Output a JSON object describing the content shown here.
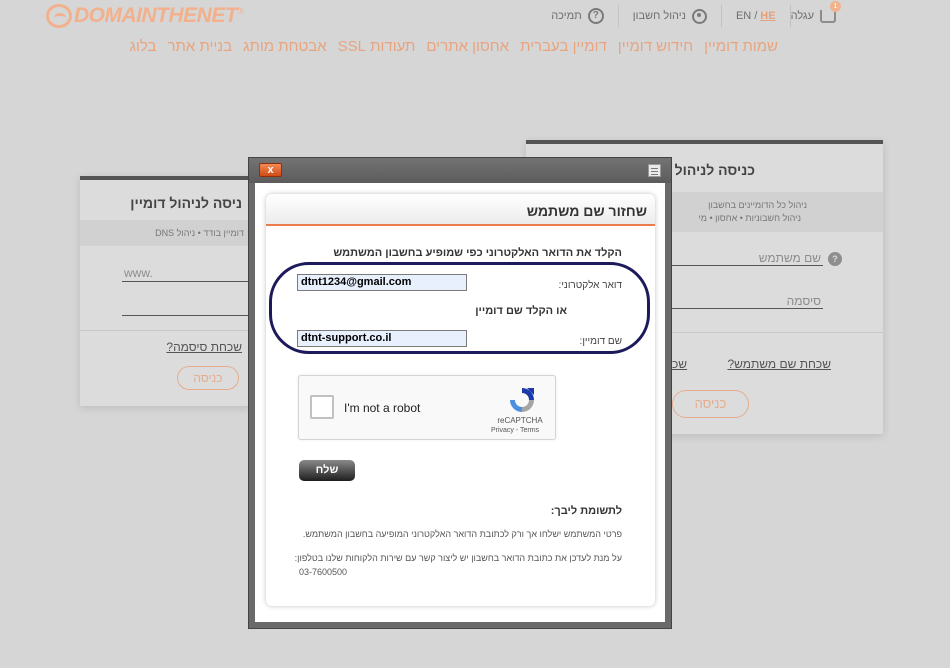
{
  "header": {
    "logo_text": "DOMAINTHENET",
    "logo_reg": "®",
    "cart_label": "עגלה",
    "cart_count": "1",
    "lang_en": "EN",
    "lang_sep": "/",
    "lang_he": "HE",
    "account_label": "ניהול חשבון",
    "help_label": "תמיכה",
    "help_glyph": "?"
  },
  "nav": {
    "items": [
      "שמות דומיין",
      "חידוש דומיין",
      "דומיין בעברית",
      "אחסון אתרים",
      "תעודות SSL",
      "אבטחת מותג",
      "בניית אתר",
      "בלוג"
    ]
  },
  "bg_left": {
    "title": "ניסה לניהול דומיין",
    "tabs": "דומיין בודד   •   ניהול DNS",
    "placeholder": "www.",
    "forgot": "שכחת סיסמה?",
    "button": "כניסה"
  },
  "bg_right": {
    "title": "כניסה לניהול חש",
    "tabs1": "ניהול כל הדומיינים בחשבון",
    "tabs2": "ניהול חשבוניות   •   אחסון   •   מי",
    "username_ph": "שם משתמש",
    "password_ph": "סיסמה",
    "forgot_user": "שכחת שם משתמש?",
    "forgot_short": "שכ",
    "button": "כניסה"
  },
  "dialog": {
    "close": "x",
    "title": "שחזור שם משתמש",
    "instruction": "הקלד את הדואר האלקטרוני כפי שמופיע בחשבון המשתמש",
    "email_label": "דואר אלקטרוני:",
    "email_value": "dtnt1234@gmail.com",
    "or_label": "או הקלד שם דומיין",
    "domain_label": "שם דומיין:",
    "domain_value": "dtnt-support.co.il",
    "captcha_text": "I'm not a robot",
    "captcha_brand": "reCAPTCHA",
    "captcha_links": "Privacy - Terms",
    "send_button": "שלח",
    "note_title": "לתשומת ליבך:",
    "note1": "פרטי המשתמש ישלחו אך ורק לכתובת הדואר האלקטרוני המופיעה בחשבון המשתמש.",
    "note2": "על מנת לעדכן את כתובת הדואר בחשבון יש ליצור קשר עם שירות הלקוחות שלנו בטלפון:",
    "note3": "03-7600500"
  }
}
